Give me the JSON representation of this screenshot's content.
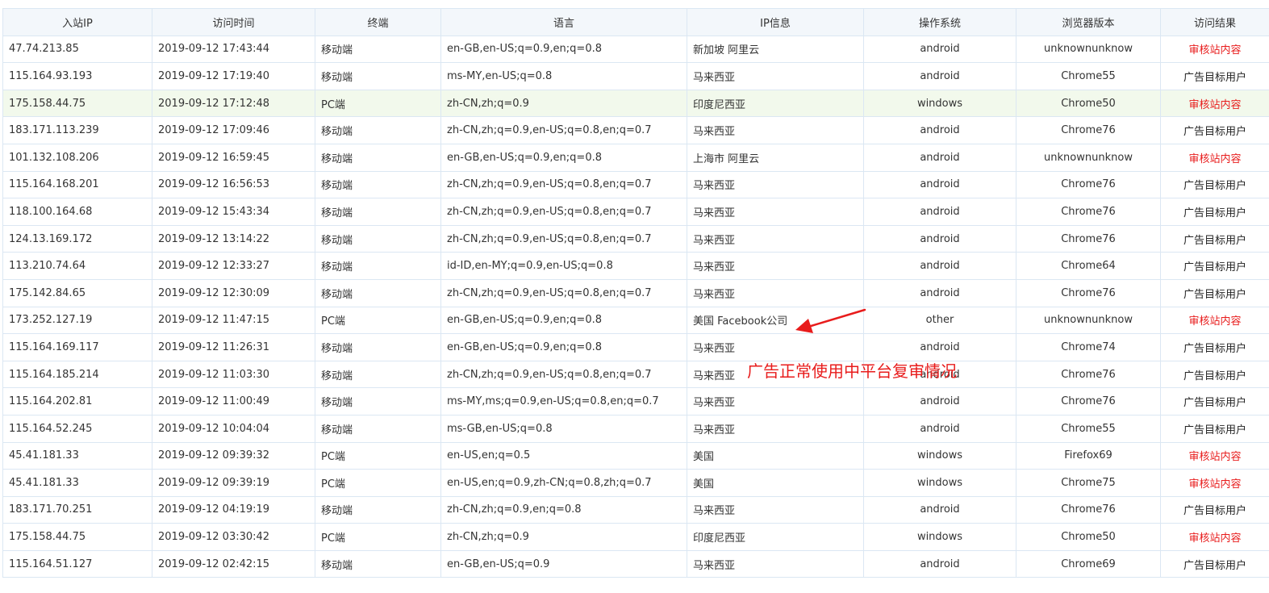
{
  "table": {
    "headers": [
      "入站IP",
      "访问时间",
      "终端",
      "语言",
      "IP信息",
      "操作系统",
      "浏览器版本",
      "访问结果"
    ],
    "rows": [
      {
        "ip": "47.74.213.85",
        "time": "2019-09-12 17:43:44",
        "terminal": "移动端",
        "language": "en-GB,en-US;q=0.9,en;q=0.8",
        "ip_info": "新加坡 阿里云",
        "os": "android",
        "browser": "unknownunknow",
        "result": "审核站内容",
        "result_color": "#e81c1c"
      },
      {
        "ip": "115.164.93.193",
        "time": "2019-09-12 17:19:40",
        "terminal": "移动端",
        "language": "ms-MY,en-US;q=0.8",
        "ip_info": "马来西亚",
        "os": "android",
        "browser": "Chrome55",
        "result": "广告目标用户",
        "result_color": "#222222"
      },
      {
        "ip": "175.158.44.75",
        "time": "2019-09-12 17:12:48",
        "terminal": "PC端",
        "language": "zh-CN,zh;q=0.9",
        "ip_info": "印度尼西亚",
        "os": "windows",
        "browser": "Chrome50",
        "result": "审核站内容",
        "result_color": "#e81c1c",
        "highlighted": true
      },
      {
        "ip": "183.171.113.239",
        "time": "2019-09-12 17:09:46",
        "terminal": "移动端",
        "language": "zh-CN,zh;q=0.9,en-US;q=0.8,en;q=0.7",
        "ip_info": "马来西亚",
        "os": "android",
        "browser": "Chrome76",
        "result": "广告目标用户",
        "result_color": "#222222"
      },
      {
        "ip": "101.132.108.206",
        "time": "2019-09-12 16:59:45",
        "terminal": "移动端",
        "language": "en-GB,en-US;q=0.9,en;q=0.8",
        "ip_info": "上海市 阿里云",
        "os": "android",
        "browser": "unknownunknow",
        "result": "审核站内容",
        "result_color": "#e81c1c"
      },
      {
        "ip": "115.164.168.201",
        "time": "2019-09-12 16:56:53",
        "terminal": "移动端",
        "language": "zh-CN,zh;q=0.9,en-US;q=0.8,en;q=0.7",
        "ip_info": "马来西亚",
        "os": "android",
        "browser": "Chrome76",
        "result": "广告目标用户",
        "result_color": "#222222"
      },
      {
        "ip": "118.100.164.68",
        "time": "2019-09-12 15:43:34",
        "terminal": "移动端",
        "language": "zh-CN,zh;q=0.9,en-US;q=0.8,en;q=0.7",
        "ip_info": "马来西亚",
        "os": "android",
        "browser": "Chrome76",
        "result": "广告目标用户",
        "result_color": "#222222"
      },
      {
        "ip": "124.13.169.172",
        "time": "2019-09-12 13:14:22",
        "terminal": "移动端",
        "language": "zh-CN,zh;q=0.9,en-US;q=0.8,en;q=0.7",
        "ip_info": "马来西亚",
        "os": "android",
        "browser": "Chrome76",
        "result": "广告目标用户",
        "result_color": "#222222"
      },
      {
        "ip": "113.210.74.64",
        "time": "2019-09-12 12:33:27",
        "terminal": "移动端",
        "language": "id-ID,en-MY;q=0.9,en-US;q=0.8",
        "ip_info": "马来西亚",
        "os": "android",
        "browser": "Chrome64",
        "result": "广告目标用户",
        "result_color": "#222222"
      },
      {
        "ip": "175.142.84.65",
        "time": "2019-09-12 12:30:09",
        "terminal": "移动端",
        "language": "zh-CN,zh;q=0.9,en-US;q=0.8,en;q=0.7",
        "ip_info": "马来西亚",
        "os": "android",
        "browser": "Chrome76",
        "result": "广告目标用户",
        "result_color": "#222222"
      },
      {
        "ip": "173.252.127.19",
        "time": "2019-09-12 11:47:15",
        "terminal": "PC端",
        "language": "en-GB,en-US;q=0.9,en;q=0.8",
        "ip_info": "美国 Facebook公司",
        "os": "other",
        "browser": "unknownunknow",
        "result": "审核站内容",
        "result_color": "#e81c1c"
      },
      {
        "ip": "115.164.169.117",
        "time": "2019-09-12 11:26:31",
        "terminal": "移动端",
        "language": "en-GB,en-US;q=0.9,en;q=0.8",
        "ip_info": "马来西亚",
        "os": "android",
        "browser": "Chrome74",
        "result": "广告目标用户",
        "result_color": "#222222"
      },
      {
        "ip": "115.164.185.214",
        "time": "2019-09-12 11:03:30",
        "terminal": "移动端",
        "language": "zh-CN,zh;q=0.9,en-US;q=0.8,en;q=0.7",
        "ip_info": "马来西亚",
        "os": "android",
        "browser": "Chrome76",
        "result": "广告目标用户",
        "result_color": "#222222"
      },
      {
        "ip": "115.164.202.81",
        "time": "2019-09-12 11:00:49",
        "terminal": "移动端",
        "language": "ms-MY,ms;q=0.9,en-US;q=0.8,en;q=0.7",
        "ip_info": "马来西亚",
        "os": "android",
        "browser": "Chrome76",
        "result": "广告目标用户",
        "result_color": "#222222"
      },
      {
        "ip": "115.164.52.245",
        "time": "2019-09-12 10:04:04",
        "terminal": "移动端",
        "language": "ms-GB,en-US;q=0.8",
        "ip_info": "马来西亚",
        "os": "android",
        "browser": "Chrome55",
        "result": "广告目标用户",
        "result_color": "#222222"
      },
      {
        "ip": "45.41.181.33",
        "time": "2019-09-12 09:39:32",
        "terminal": "PC端",
        "language": "en-US,en;q=0.5",
        "ip_info": "美国",
        "os": "windows",
        "browser": "Firefox69",
        "result": "审核站内容",
        "result_color": "#e81c1c"
      },
      {
        "ip": "45.41.181.33",
        "time": "2019-09-12 09:39:19",
        "terminal": "PC端",
        "language": "en-US,en;q=0.9,zh-CN;q=0.8,zh;q=0.7",
        "ip_info": "美国",
        "os": "windows",
        "browser": "Chrome75",
        "result": "审核站内容",
        "result_color": "#e81c1c"
      },
      {
        "ip": "183.171.70.251",
        "time": "2019-09-12 04:19:19",
        "terminal": "移动端",
        "language": "zh-CN,zh;q=0.9,en;q=0.8",
        "ip_info": "马来西亚",
        "os": "android",
        "browser": "Chrome76",
        "result": "广告目标用户",
        "result_color": "#222222"
      },
      {
        "ip": "175.158.44.75",
        "time": "2019-09-12 03:30:42",
        "terminal": "PC端",
        "language": "zh-CN,zh;q=0.9",
        "ip_info": "印度尼西亚",
        "os": "windows",
        "browser": "Chrome50",
        "result": "审核站内容",
        "result_color": "#e81c1c"
      },
      {
        "ip": "115.164.51.127",
        "time": "2019-09-12 02:42:15",
        "terminal": "移动端",
        "language": "en-GB,en-US;q=0.9",
        "ip_info": "马来西亚",
        "os": "android",
        "browser": "Chrome69",
        "result": "广告目标用户",
        "result_color": "#222222"
      }
    ]
  },
  "annotation": {
    "text": "广告正常使用中平台复审情况",
    "color": "#e81c1c",
    "arrow_icon": "arrow-icon"
  },
  "colors": {
    "header_bg": "#f3f7fb",
    "border": "#dbe7f3",
    "highlight_row": "#f2f9ec",
    "review_red": "#e81c1c"
  }
}
